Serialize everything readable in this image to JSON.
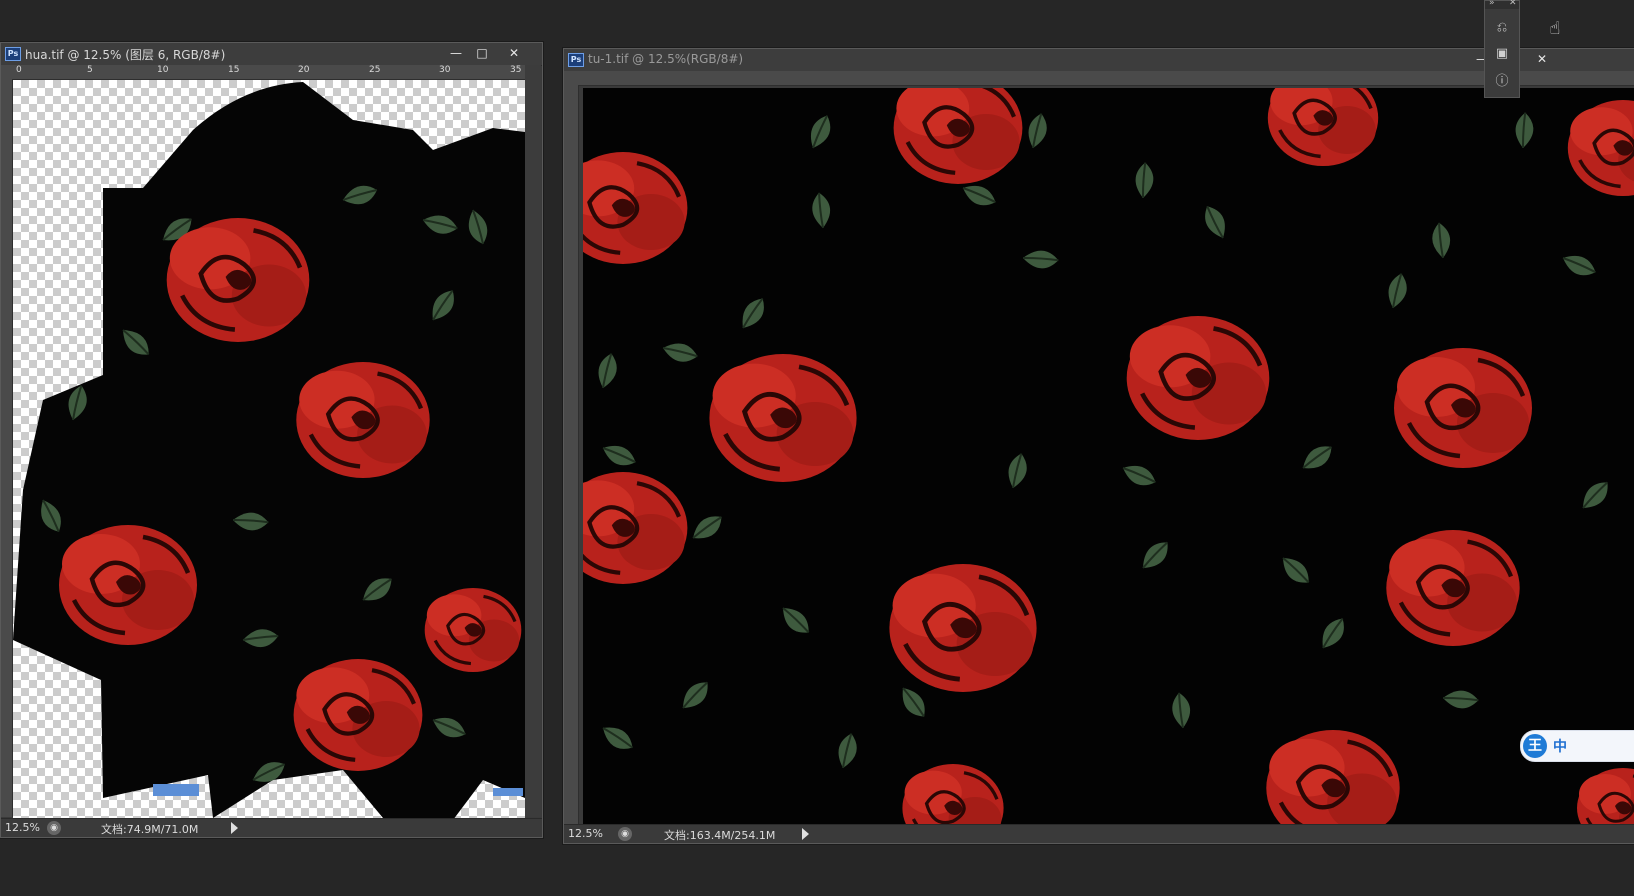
{
  "window1": {
    "icon": "Ps",
    "title": "hua.tif @ 12.5% (图层 6, RGB/8#)",
    "ruler_ticks": [
      "0",
      "5",
      "10",
      "15",
      "20",
      "25",
      "30",
      "35"
    ],
    "status_zoom": "12.5%",
    "status_doc": "文档:74.9M/71.0M"
  },
  "window2": {
    "icon": "Ps",
    "title": "tu-1.tif @ 12.5%(RGB/8#)",
    "status_zoom": "12.5%",
    "status_doc": "文档:163.4M/254.1M"
  },
  "window_buttons": {
    "minimize": "—",
    "maximize": "□",
    "close": "✕"
  },
  "ime": {
    "logo": "王",
    "label": "中"
  },
  "colors": {
    "rose_red": "#b8221c",
    "leaf_green": "#3e5a3e",
    "fabric_black": "#050505",
    "app_bg": "#262626"
  },
  "icons": [
    "ps-icon",
    "minimize-icon",
    "maximize-icon",
    "close-icon",
    "history-icon",
    "properties-icon",
    "info-icon",
    "status-info-icon",
    "status-arrow-icon",
    "hand-tool-icon",
    "ime-logo-icon"
  ]
}
